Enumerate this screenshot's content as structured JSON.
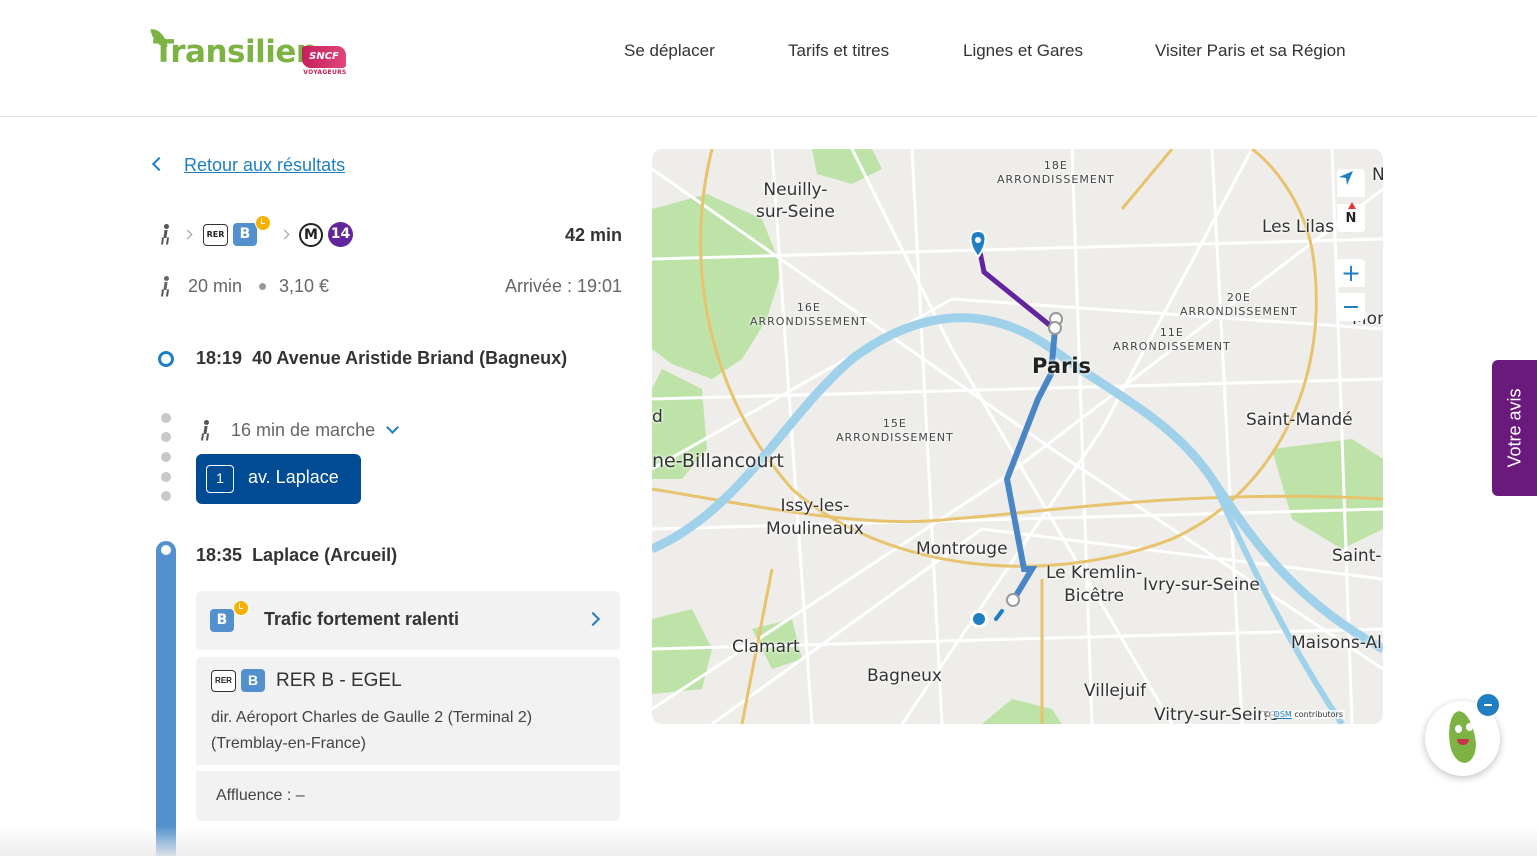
{
  "brand": {
    "name": "Transilien",
    "partner": "SNCF",
    "partner_sub": "VOYAGEURS",
    "accent": "#7cb342",
    "sncf_color": "#c5205b"
  },
  "nav": {
    "items": [
      "Se déplacer",
      "Tarifs et titres",
      "Lignes et Gares",
      "Visiter Paris et sa Région"
    ]
  },
  "back_link": "Retour aux résultats",
  "journey": {
    "modes": [
      {
        "type": "walk",
        "icon": "walker-icon"
      },
      {
        "type": "rer",
        "label": "RER",
        "line": "B",
        "line_color": "#5291ce",
        "disrupted": true
      },
      {
        "type": "metro",
        "label": "M",
        "line": "14",
        "line_color": "#62259d"
      }
    ],
    "duration": "42 min",
    "walk_time": "20 min",
    "price": "3,10 €",
    "arrival": "Arrivée : 19:01"
  },
  "steps": {
    "origin": {
      "time": "18:19",
      "place": "40 Avenue Aristide Briand (Bagneux)"
    },
    "walk": {
      "text": "16 min de marche"
    },
    "bus": {
      "number": "1",
      "stop": "av. Laplace"
    },
    "rer_stop": {
      "time": "18:35",
      "place": "Laplace (Arcueil)"
    },
    "alert": {
      "line": "B",
      "text": "Trafic fortement ralenti"
    },
    "train": {
      "mode_label": "RER",
      "line": "B",
      "name": "RER B - EGEL",
      "direction": "dir. Aéroport Charles de Gaulle 2 (Terminal 2) (Tremblay-en-France)",
      "affluence": "Affluence : –"
    }
  },
  "map": {
    "labels": {
      "neuilly": "Neuilly-\nsur-Seine",
      "arr18": "18E\nARRONDISSEMENT",
      "leslilas": "Les Lilas",
      "arr16": "16E\nARRONDISSEMENT",
      "arr20": "20E\nARRONDISSEMENT",
      "arr11": "11E\nARRONDISSEMENT",
      "paris": "Paris",
      "arr15": "15E\nARRONDISSEMENT",
      "saintmande": "Saint-Mandé",
      "billancourt": "ne-Billancourt",
      "issy": "Issy-les-\nMoulineaux",
      "montrouge": "Montrouge",
      "kremlin": "Le Kremlin-\nBicêtre",
      "ivry": "Ivry-sur-Seine",
      "clamart": "Clamart",
      "bagneux": "Bagneux",
      "maisons": "Maisons-Al",
      "villejuif": "Villejuif",
      "vitry": "Vitry-sur-Seine",
      "mon": "Mon",
      "saint": "Saint-I",
      "n": "N",
      "d": "d"
    },
    "compass_label": "N",
    "credit_osm": "OSM",
    "credit_contrib": "contributors",
    "route_colors": {
      "rer": "#4a86c6",
      "metro": "#62259d",
      "walk": "#1f7fc2"
    }
  },
  "feedback_tab": "Votre avis"
}
